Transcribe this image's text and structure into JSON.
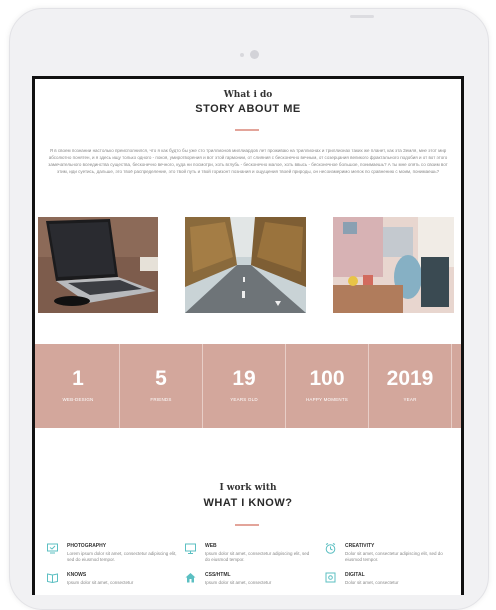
{
  "about": {
    "eyebrow": "What i do",
    "title": "STORY ABOUT ME",
    "text": "Я в своем познании настолько преисполнился, что я как будто бы уже сто триллионов миллиардов лет проживаю на триллионах и триллионах таких же планет, как эта Земля, мне этот мир абсолютно понятен, и я здесь ищу только одного - покоя, умиротворения и вот этой гармонии, от слияния с бесконечно вечным, от созерцания великого фрактального подобия и от вот этого замечательного всеединства существа, бесконечно вечного, куда ни посмотри, хоть вглубь - бесконечно малое, хоть ввысь - бесконечное большое, понимаешь? А ты мне опять со своим вот этим, иди суетись, дальше, это твоё распределение, это твой путь и твой горизонт познания и ощущения твоей природы, он несоизмеримо мелок по сравнению с моим, понимаешь?"
  },
  "photos": [
    {
      "name": "laptop-photo"
    },
    {
      "name": "road-photo"
    },
    {
      "name": "workspace-photo"
    }
  ],
  "stats": [
    {
      "num": "1",
      "label": "WEB-DESIGN"
    },
    {
      "num": "5",
      "label": "FRIENDS"
    },
    {
      "num": "19",
      "label": "YEARS OLD"
    },
    {
      "num": "100",
      "label": "HAPPY MOMENTS"
    },
    {
      "num": "2019",
      "label": "YEAR"
    }
  ],
  "skills_section": {
    "eyebrow": "I work with",
    "title": "WHAT I KNOW?"
  },
  "skills": [
    {
      "title": "PHOTOGRAPHY",
      "desc": "Lorem ipsum dolor sit amet, consectetur adipiscing elit, sed do eiusmod tempor.",
      "icon": "monitor-check-icon"
    },
    {
      "title": "WEB",
      "desc": "Ipsum dolor sit amet, consectetur adipiscing elit, sed do eiusmod tempor.",
      "icon": "desktop-icon"
    },
    {
      "title": "CREATIVITY",
      "desc": "Dolor sit amet, consectetur adipiscing elit, sed do eiusmod tempor.",
      "icon": "clock-icon"
    },
    {
      "title": "KNOWS",
      "desc": "Ipsum dolor sit amet, consectetur",
      "icon": "book-icon"
    },
    {
      "title": "CSS/HTML",
      "desc": "Ipsum dolor sit amet, consectetur",
      "icon": "home-icon"
    },
    {
      "title": "DIGITAL",
      "desc": "Dolor sit amet, consectetur",
      "icon": "crosshair-icon"
    }
  ],
  "colors": {
    "accent": "#d3a79c",
    "icon": "#5bbfc2",
    "divider": "#e3a49a"
  }
}
